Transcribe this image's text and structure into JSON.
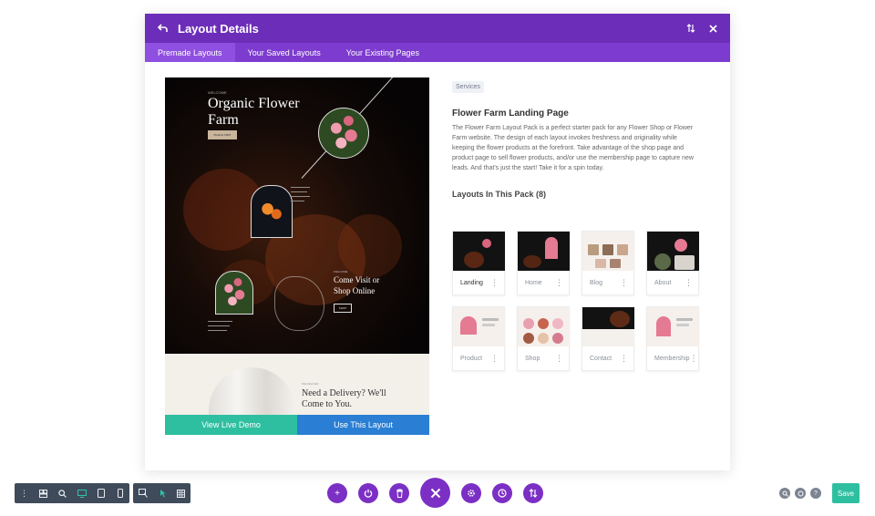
{
  "modal": {
    "title": "Layout Details",
    "tabs": [
      {
        "label": "Premade Layouts"
      },
      {
        "label": "Your Saved Layouts"
      },
      {
        "label": "Your Existing Pages"
      }
    ]
  },
  "preview": {
    "hero_small": "WELCOME",
    "hero_title": "Organic Flower Farm",
    "hero_button": "PLAN A VISIT",
    "visit_small": "WELCOME",
    "visit_title": "Come Visit or Shop Online",
    "visit_button": "SHOP",
    "delivery_small": "WE DELIVER",
    "delivery_title": "Need a Delivery? We'll Come to You.",
    "demo_button": "View Live Demo",
    "use_button": "Use This Layout"
  },
  "info": {
    "tag": "Services",
    "title": "Flower Farm Landing Page",
    "description": "The Flower Farm Layout Pack is a perfect starter pack for any Flower Shop or Flower Farm website. The design of each layout invokes freshness and originality while keeping the flower products at the forefront. Take advantage of the shop page and product page to sell flower products, and/or use the membership page to capture new leads. And that's just the start! Take it for a spin today.",
    "layouts_heading": "Layouts In This Pack (8)",
    "layouts": [
      {
        "label": "Landing",
        "theme": "dark"
      },
      {
        "label": "Home",
        "theme": "dark"
      },
      {
        "label": "Blog",
        "theme": "light"
      },
      {
        "label": "About",
        "theme": "dark"
      },
      {
        "label": "Product",
        "theme": "light"
      },
      {
        "label": "Shop",
        "theme": "light"
      },
      {
        "label": "Contact",
        "theme": "dark"
      },
      {
        "label": "Membership",
        "theme": "light"
      }
    ]
  },
  "footer": {
    "save_label": "Save"
  },
  "colors": {
    "header": "#6c2eb9",
    "tabs": "#7d3bcf",
    "demo": "#2ebfa0",
    "use": "#2a7fd4",
    "toolbar": "#3f4b5b",
    "round_buttons": "#7b2fc4"
  }
}
